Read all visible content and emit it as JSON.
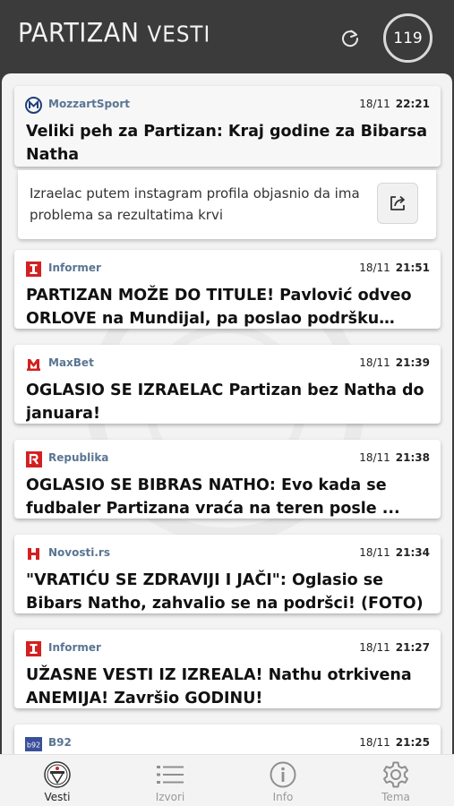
{
  "header": {
    "brand_main": "PARTIZAN",
    "brand_sub": "VESTI",
    "unread_count": "119",
    "refresh_icon": "refresh-icon"
  },
  "expanded_article": {
    "source": "MozzartSport",
    "source_icon": "mozzartsport-logo",
    "date": "18/11",
    "time": "22:21",
    "title": "Veliki peh za Partizan: Kraj godine za Bibarsa Natha",
    "summary": "Izraelac putem instagram profila objasnio da ima problema sa rezultatima krvi",
    "share_icon": "share-icon"
  },
  "articles": [
    {
      "source": "Informer",
      "source_icon": "informer-logo",
      "date": "18/11",
      "time": "21:51",
      "title": "PARTIZAN MOŽE DO TITULE! Pavlović odveo ORLOVE na Mundijal, pa poslao podršku CRNO..."
    },
    {
      "source": "MaxBet",
      "source_icon": "maxbet-logo",
      "date": "18/11",
      "time": "21:39",
      "title": "OGLASIO SE IZRAELAC Partizan bez Natha do januara!"
    },
    {
      "source": "Republika",
      "source_icon": "republika-logo",
      "date": "18/11",
      "time": "21:38",
      "title": "OGLASIO SE BIBRAS NATHO: Evo kada se fudbaler Partizana vraća na teren posle ..."
    },
    {
      "source": "Novosti.rs",
      "source_icon": "novosti-logo",
      "date": "18/11",
      "time": "21:34",
      "title": "\"VRATIĆU SE ZDRAVIJI I JAČI\": Oglasio se Bibars Natho, zahvalio se na podršci! (FOTO)"
    },
    {
      "source": "Informer",
      "source_icon": "informer-logo",
      "date": "18/11",
      "time": "21:27",
      "title": "UŽASNE VESTI IZ IZREALA! Nathu otrkivena ANEMIJA! Završio GODINU!"
    },
    {
      "source": "B92",
      "source_icon": "b92-logo",
      "date": "18/11",
      "time": "21:25",
      "title": ""
    }
  ],
  "nav": [
    {
      "label": "Vesti",
      "icon": "partizan-crest-icon",
      "active": true
    },
    {
      "label": "Izvori",
      "icon": "list-icon",
      "active": false
    },
    {
      "label": "Info",
      "icon": "info-icon",
      "active": false
    },
    {
      "label": "Tema",
      "icon": "gear-icon",
      "active": false
    }
  ],
  "colors": {
    "header_bg": "#3b3b3b",
    "content_bg": "#f3f3f3",
    "source_text": "#5a7593",
    "informer_red": "#d32020",
    "b92_blue": "#3a4f9a",
    "mozzart_blue": "#1f3f7a"
  }
}
